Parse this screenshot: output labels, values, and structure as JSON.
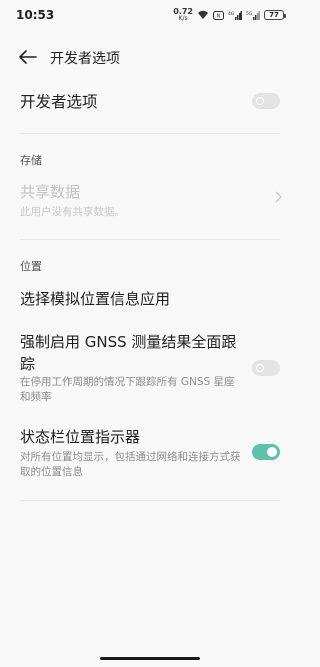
{
  "status_bar": {
    "time": "10:53",
    "net_speed_value": "0.72",
    "net_speed_unit": "K/s",
    "signal_label_1": "4G",
    "signal_label_2": "5G",
    "battery_level": "77"
  },
  "app_bar": {
    "title": "开发者选项",
    "back_icon": "arrow-back-icon"
  },
  "developer_toggle": {
    "label": "开发者选项",
    "state": "off"
  },
  "storage": {
    "header": "存储",
    "shared_data": {
      "title": "共享数据",
      "subtitle": "此用户没有共享数据。"
    }
  },
  "location": {
    "header": "位置",
    "mock_location": {
      "title": "选择模拟位置信息应用"
    },
    "gnss": {
      "title": "强制启用 GNSS 测量结果全面跟踪",
      "subtitle": "在停用工作周期的情况下跟踪所有 GNSS 星座和频率",
      "state": "off"
    },
    "status_bar_indicator": {
      "title": "状态栏位置指示器",
      "subtitle": "对所有位置均显示，包括通过网络和连接方式获取的位置信息",
      "state": "on"
    }
  },
  "colors": {
    "accent": "#5cc2ad",
    "background": "#f8f8f8",
    "toggle_off": "#e3e3e3"
  }
}
